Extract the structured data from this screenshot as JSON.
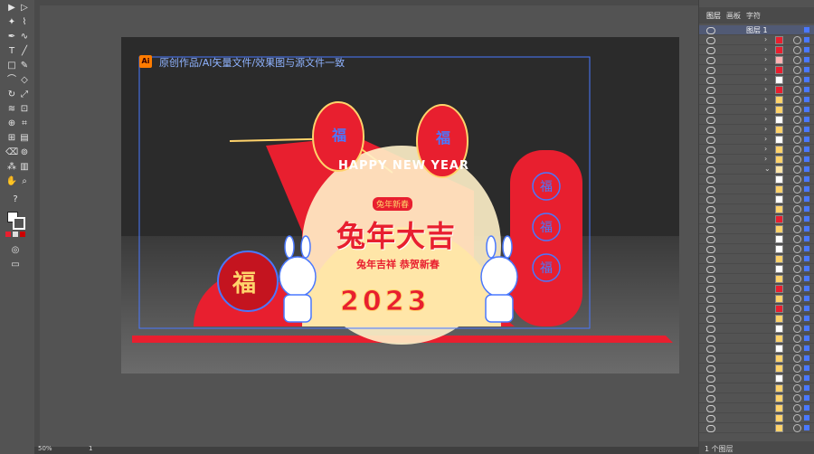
{
  "app": {
    "artboard_label_icon": "Ai",
    "artboard_promo_text": "原创作品/AI矢量文件/效果图与源文件一致"
  },
  "design": {
    "headline_cn": "兔年大吉",
    "happy_new_year": "HAPPY NEW YEAR",
    "tag_top": "兔年新春",
    "tagline": "兔年吉祥 恭贺新春",
    "year": "2023",
    "fu": "福",
    "colors": {
      "red": "#e81f2f",
      "dark_red": "#c4141f",
      "gold": "#ffd36b",
      "cream": "#fff1c9",
      "blue_outline": "#4a78ff"
    }
  },
  "status": {
    "zoom": "50%",
    "page": "1"
  },
  "panel": {
    "tabs": [
      "图层",
      "画板",
      "字符"
    ],
    "root_layer": "图层 1",
    "layer_count": "1 个图层"
  }
}
